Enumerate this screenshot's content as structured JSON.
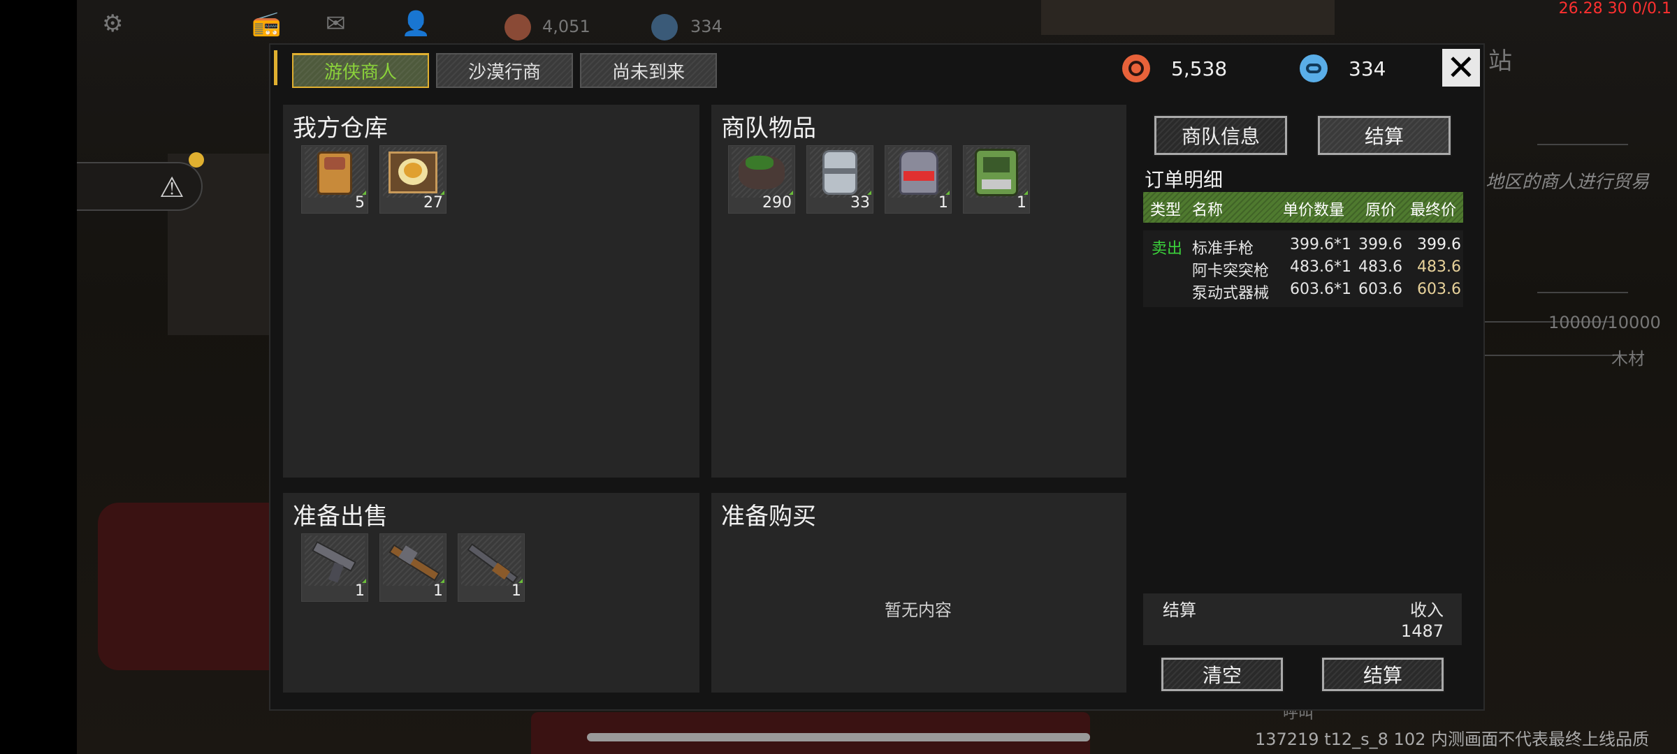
{
  "hud": {
    "coin_value": "4,051",
    "gear_value": "334",
    "fps_text": "26.28 30 0/0.1"
  },
  "background": {
    "side_text": "地区的商人进行贸易",
    "progress_text": "10000/10000",
    "wood_label": "木材",
    "station_char": "站",
    "call_label": "呼叫",
    "build_info": "137219 t12_s_8 102  内测画面不代表最终上线品质"
  },
  "tabs": [
    {
      "label": "游侠商人",
      "active": true
    },
    {
      "label": "沙漠行商",
      "active": false
    },
    {
      "label": "尚未到来",
      "active": false
    }
  ],
  "resources": {
    "coins": "5,538",
    "gears": "334"
  },
  "panels": {
    "my_warehouse": {
      "title": "我方仓库",
      "items": [
        {
          "icon": "backpack-icon",
          "qty": "5"
        },
        {
          "icon": "food-plate-icon",
          "qty": "27"
        }
      ]
    },
    "caravan_goods": {
      "title": "商队物品",
      "items": [
        {
          "icon": "moss-rock-icon",
          "qty": "290"
        },
        {
          "icon": "metal-canister-icon",
          "qty": "33"
        },
        {
          "icon": "helmet-icon",
          "qty": "1"
        },
        {
          "icon": "armor-vest-icon",
          "qty": "1"
        }
      ]
    },
    "ready_to_sell": {
      "title": "准备出售",
      "items": [
        {
          "icon": "pistol-icon",
          "qty": "1"
        },
        {
          "icon": "rifle-icon",
          "qty": "1"
        },
        {
          "icon": "shotgun-icon",
          "qty": "1"
        }
      ]
    },
    "ready_to_buy": {
      "title": "准备购买",
      "empty_text": "暂无内容"
    }
  },
  "order": {
    "caravan_info_label": "商队信息",
    "checkout_top_label": "结算",
    "title": "订单明细",
    "headers": {
      "type": "类型",
      "name": "名称",
      "unit_qty": "单价数量",
      "orig": "原价",
      "final": "最终价"
    },
    "rows": [
      {
        "type": "卖出",
        "name": "标准手枪",
        "unit_qty": "399.6*1",
        "orig": "399.6",
        "final": "399.6"
      },
      {
        "type": "",
        "name": "阿卡突突枪",
        "unit_qty": "483.6*1",
        "orig": "483.6",
        "final": "483.6"
      },
      {
        "type": "",
        "name": "泵动式器械",
        "unit_qty": "603.6*1",
        "orig": "603.6",
        "final": "603.6"
      }
    ],
    "settle_label": "结算",
    "income_label": "收入",
    "income_value": "1487",
    "clear_label": "清空",
    "checkout_bottom_label": "结算"
  },
  "colors": {
    "accent": "#e0b030",
    "active_tab_text": "#8bd23b",
    "sell_type": "#3bd23b",
    "final_price": "#e8d29a",
    "coin_icon": "#e8623a",
    "gear_icon": "#5aaee8"
  }
}
